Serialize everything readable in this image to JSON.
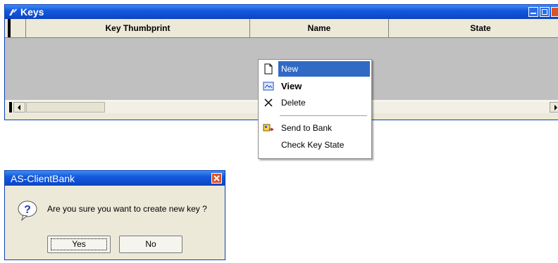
{
  "keys_window": {
    "title": "Keys",
    "columns": [
      "Key Thumbprint",
      "Name",
      "State"
    ]
  },
  "context_menu": {
    "items": [
      {
        "label": "New",
        "icon": "new-document-icon",
        "highlighted": true
      },
      {
        "label": "View",
        "icon": "view-icon",
        "bold": true
      },
      {
        "label": "Delete",
        "icon": "delete-icon"
      },
      {
        "label": "Send to Bank",
        "icon": "send-to-bank-icon"
      },
      {
        "label": "Check Key State",
        "icon": ""
      }
    ]
  },
  "dialog": {
    "title": "AS-ClientBank",
    "message": "Are you sure you want to create new key ?",
    "yes_label": "Yes",
    "no_label": "No",
    "icon": "question-icon"
  },
  "colors": {
    "titlebar": "#0a3fb5",
    "menu_highlight": "#316ac5",
    "grid_bg": "#c0c0c0"
  }
}
